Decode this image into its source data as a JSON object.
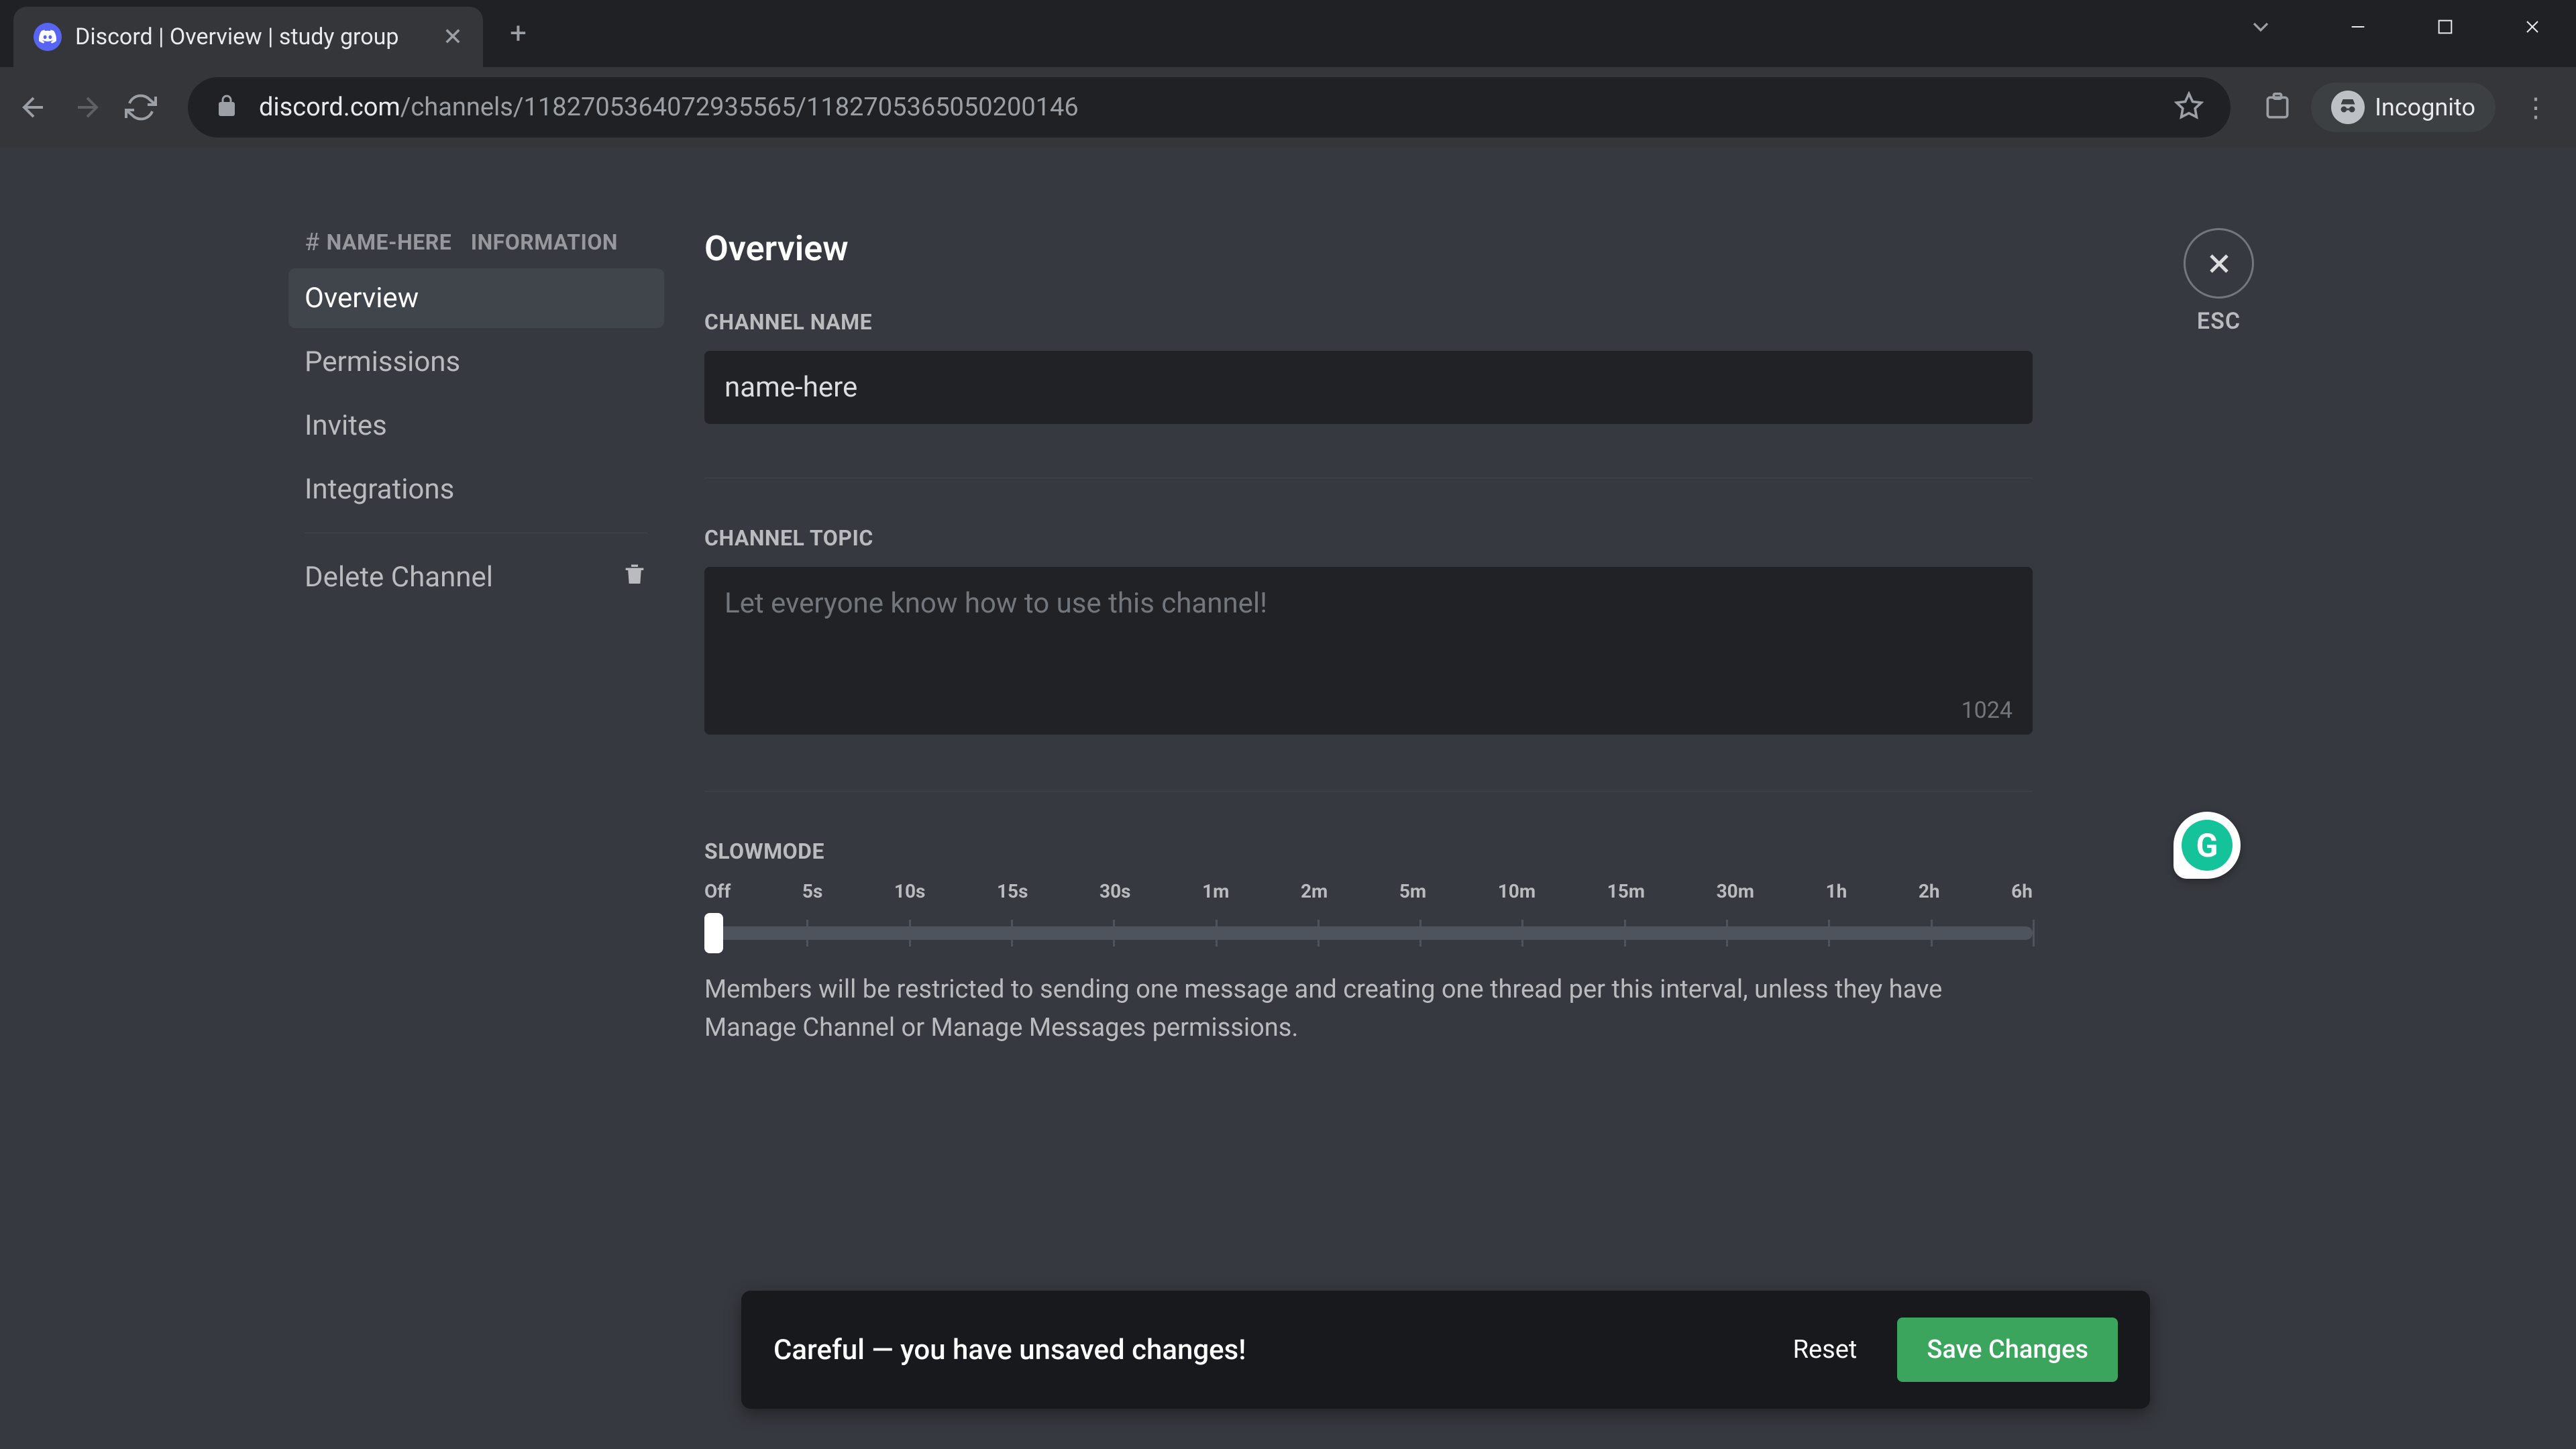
{
  "browser": {
    "tab_title": "Discord | Overview | study group",
    "url_domain": "discord.com",
    "url_path": "/channels/1182705364072935565/1182705365050200146",
    "incognito_label": "Incognito"
  },
  "sidebar": {
    "header_channel": "NAME-HERE",
    "header_suffix": "INFORMATION",
    "items": [
      {
        "label": "Overview"
      },
      {
        "label": "Permissions"
      },
      {
        "label": "Invites"
      },
      {
        "label": "Integrations"
      }
    ],
    "delete_label": "Delete Channel"
  },
  "page": {
    "title": "Overview",
    "channel_name_label": "Channel Name",
    "channel_name_value": "name-here",
    "channel_topic_label": "Channel Topic",
    "channel_topic_placeholder": "Let everyone know how to use this channel!",
    "channel_topic_charcount": "1024",
    "slowmode_label": "Slowmode",
    "slowmode_ticks": [
      "Off",
      "5s",
      "10s",
      "15s",
      "30s",
      "1m",
      "2m",
      "5m",
      "10m",
      "15m",
      "30m",
      "1h",
      "2h",
      "6h"
    ],
    "slowmode_desc": "Members will be restricted to sending one message and creating one thread per this interval, unless they have Manage Channel or Manage Messages permissions."
  },
  "close": {
    "esc_label": "ESC"
  },
  "toast": {
    "message": "Careful — you have unsaved changes!",
    "reset": "Reset",
    "save": "Save Changes"
  },
  "grammarly": {
    "glyph": "G"
  }
}
